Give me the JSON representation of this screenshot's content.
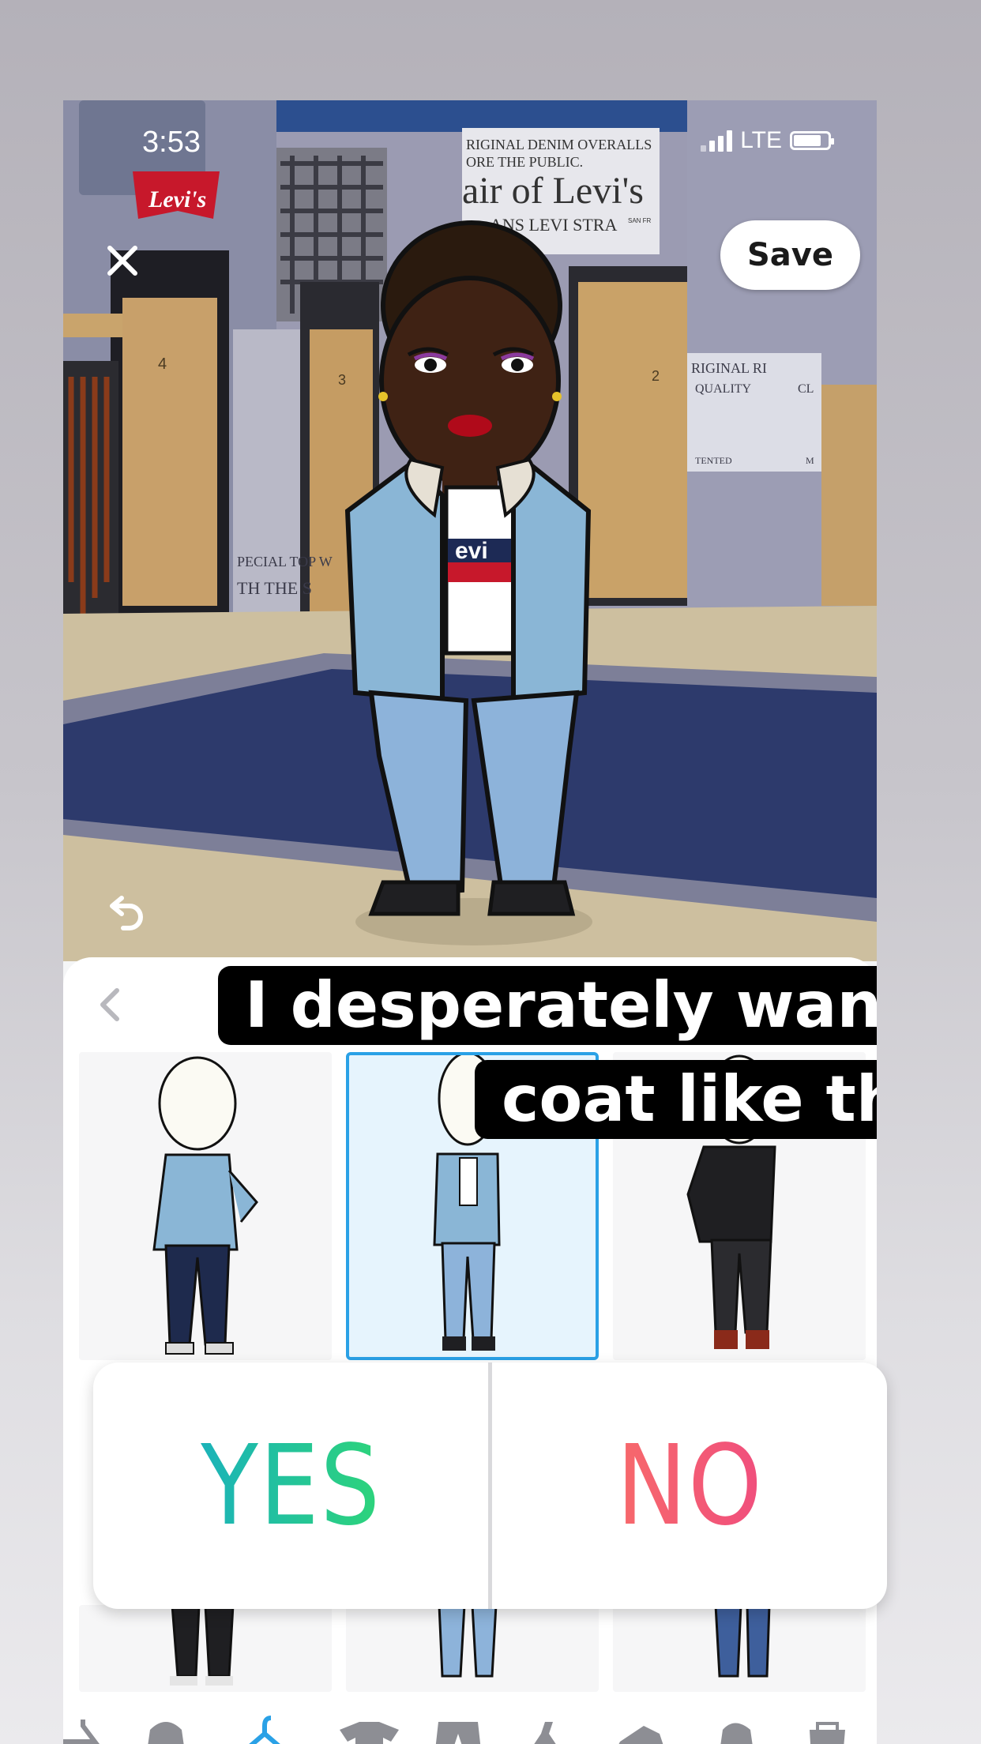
{
  "status_bar": {
    "time": "3:53",
    "network": "LTE"
  },
  "header": {
    "save_label": "Save"
  },
  "scene": {
    "store_sign": "Levi's",
    "poster_top_lines": [
      "RIGINAL DENIM OVERALLS",
      "ORE THE PUBLIC.",
      "air of Levi's",
      "ANS  LEVI STRA",
      "SAN FR"
    ],
    "poster_left_lines": [
      "PECIAL TOP W",
      "TH THE S"
    ],
    "poster_right_lines": [
      "RIGINAL RI",
      "QUALITY",
      "CL",
      "TENTED",
      "M"
    ],
    "avatar_shirt_text": "evi",
    "fitting_room_numbers": [
      "4",
      "3",
      "2"
    ]
  },
  "caption": {
    "line1": "I desperately want a",
    "line2": "coat like this"
  },
  "poll": {
    "yes": "YES",
    "no": "NO"
  },
  "colors": {
    "selected_border": "#2aa1e6",
    "yes_gradient": [
      "#1bb3b9",
      "#2dd47a"
    ],
    "no_gradient": [
      "#f7696b",
      "#f04e7d"
    ]
  },
  "outfits": [
    {
      "name": "denim-jacket-dark-jeans",
      "selected": false
    },
    {
      "name": "denim-sherpa-jacket-light-jeans",
      "selected": true
    },
    {
      "name": "black-leather-jacket",
      "selected": false
    }
  ],
  "tabbar_icons": [
    "hanger-partial-icon",
    "hoodie-icon",
    "hanger-icon",
    "tshirt-icon",
    "pants-icon",
    "dress-icon",
    "shoe-icon",
    "coat-icon",
    "bag-icon"
  ],
  "active_tab": "hanger-icon"
}
